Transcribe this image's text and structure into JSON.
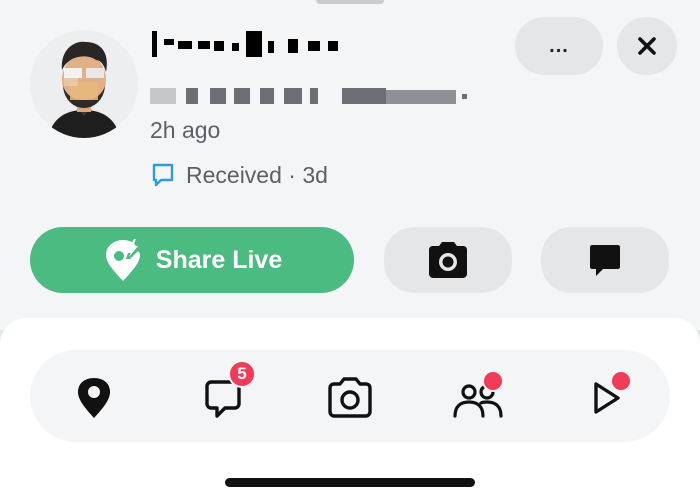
{
  "profile": {
    "name": "",
    "location": "",
    "last_seen": "2h ago",
    "received": "Received · 3d"
  },
  "header": {
    "more_label": "...",
    "close_icon": "close-icon"
  },
  "actions": {
    "share_live_label": "Share Live",
    "camera_icon": "camera-icon",
    "chat_icon": "chat-icon"
  },
  "nav": {
    "items": [
      {
        "icon": "map-pin-icon"
      },
      {
        "icon": "chat-icon",
        "badge": "5"
      },
      {
        "icon": "camera-icon"
      },
      {
        "icon": "friends-icon",
        "dot": true
      },
      {
        "icon": "stories-play-icon",
        "dot": true
      }
    ]
  },
  "colors": {
    "share_green": "#4bbb81",
    "badge_red": "#f23c57",
    "received_blue": "#2f9bd8"
  }
}
